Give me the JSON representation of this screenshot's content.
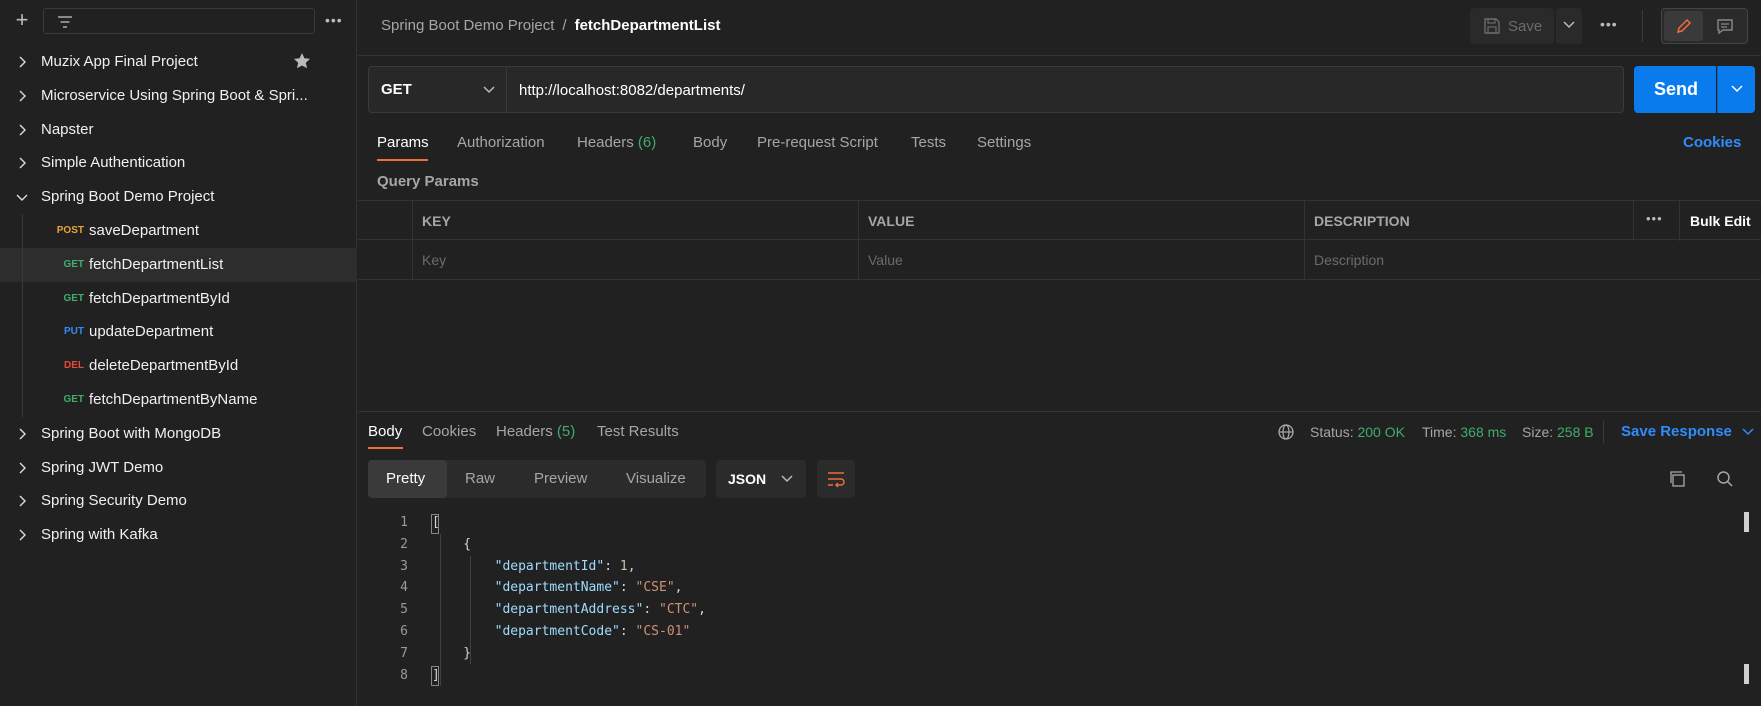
{
  "sidebar": {
    "filter_placeholder": "",
    "collections": [
      {
        "label": "Muzix App Final Project",
        "expanded": false,
        "starred": true
      },
      {
        "label": "Microservice Using Spring Boot & Spri...",
        "expanded": false
      },
      {
        "label": "Napster",
        "expanded": false
      },
      {
        "label": "Simple Authentication",
        "expanded": false
      },
      {
        "label": "Spring Boot Demo Project",
        "expanded": true
      }
    ],
    "requests": [
      {
        "method": "POST",
        "label": "saveDepartment",
        "color": "#e7a53a"
      },
      {
        "method": "GET",
        "label": "fetchDepartmentList",
        "color": "#3fae6a",
        "active": true
      },
      {
        "method": "GET",
        "label": "fetchDepartmentById",
        "color": "#3fae6a"
      },
      {
        "method": "PUT",
        "label": "updateDepartment",
        "color": "#2f8dfa"
      },
      {
        "method": "DEL",
        "label": "deleteDepartmentById",
        "color": "#e24b3a"
      },
      {
        "method": "GET",
        "label": "fetchDepartmentByName",
        "color": "#3fae6a"
      }
    ],
    "collections_after": [
      {
        "label": "Spring Boot with MongoDB"
      },
      {
        "label": "Spring JWT Demo"
      },
      {
        "label": "Spring Security Demo"
      },
      {
        "label": "Spring with Kafka"
      }
    ]
  },
  "header": {
    "breadcrumb_parent": "Spring Boot Demo Project",
    "breadcrumb_sep": "/",
    "breadcrumb_current": "fetchDepartmentList",
    "save_label": "Save"
  },
  "request": {
    "method": "GET",
    "url": "http://localhost:8082/departments/",
    "send_label": "Send",
    "tabs": [
      {
        "label": "Params",
        "active": true
      },
      {
        "label": "Authorization"
      },
      {
        "label": "Headers",
        "count": "(6)"
      },
      {
        "label": "Body"
      },
      {
        "label": "Pre-request Script"
      },
      {
        "label": "Tests"
      },
      {
        "label": "Settings"
      }
    ],
    "cookies_label": "Cookies",
    "query_params_label": "Query Params",
    "table": {
      "headers": [
        "KEY",
        "VALUE",
        "DESCRIPTION"
      ],
      "placeholders": [
        "Key",
        "Value",
        "Description"
      ],
      "bulk_edit": "Bulk Edit"
    }
  },
  "response": {
    "tabs": [
      {
        "label": "Body",
        "active": true
      },
      {
        "label": "Cookies"
      },
      {
        "label": "Headers",
        "count": "(5)"
      },
      {
        "label": "Test Results"
      }
    ],
    "status_label": "Status:",
    "status_value": "200 OK",
    "time_label": "Time:",
    "time_value": "368 ms",
    "size_label": "Size:",
    "size_value": "258 B",
    "save_response_label": "Save Response",
    "views": [
      "Pretty",
      "Raw",
      "Preview",
      "Visualize"
    ],
    "format": "JSON",
    "body": {
      "department_id_key": "\"departmentId\"",
      "department_id_val": "1",
      "department_name_key": "\"departmentName\"",
      "department_name_val": "\"CSE\"",
      "department_address_key": "\"departmentAddress\"",
      "department_address_val": "\"CTC\"",
      "department_code_key": "\"departmentCode\"",
      "department_code_val": "\"CS-01\""
    },
    "line_numbers": [
      "1",
      "2",
      "3",
      "4",
      "5",
      "6",
      "7",
      "8"
    ]
  },
  "colors": {
    "accent_orange": "#f26b3a",
    "send_blue": "#097bed",
    "status_green": "#3fae6a",
    "link_blue": "#2f8dfa"
  }
}
